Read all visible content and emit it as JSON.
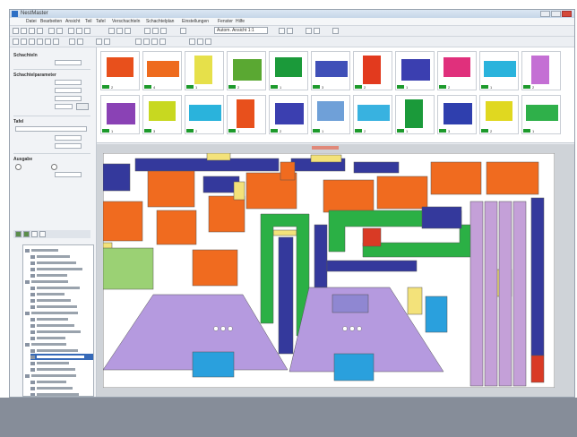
{
  "window": {
    "title": "NestMaster"
  },
  "menubar": [
    "Datei",
    "Bearbeiten",
    "Ansicht",
    "Teil",
    "Tafel",
    "Verschachteln",
    "Schachtelplan",
    "Einstellungen",
    "Fenster",
    "Hilfe"
  ],
  "toolbar": {
    "combo_value": "Autom. Ansicht 1:1"
  },
  "left_panel": {
    "sections": [
      "Schachteln",
      "Schachtelparameter",
      "Tafel",
      "Ausgabe"
    ]
  },
  "part_thumbnails": [
    {
      "color": "#e8501c",
      "qty": "2"
    },
    {
      "color": "#ee6b1e",
      "qty": "4"
    },
    {
      "color": "#e6e04a",
      "qty": "1"
    },
    {
      "color": "#5aa832",
      "qty": "2"
    },
    {
      "color": "#1b9a3a",
      "qty": "1"
    },
    {
      "color": "#4050b8",
      "qty": "3"
    },
    {
      "color": "#e23a1e",
      "qty": "2"
    },
    {
      "color": "#3b3fb0",
      "qty": "1"
    },
    {
      "color": "#e0307c",
      "qty": "2"
    },
    {
      "color": "#2ab3dc",
      "qty": "1"
    },
    {
      "color": "#c46fd4",
      "qty": "2"
    },
    {
      "color": "#8a42b5",
      "qty": "1"
    },
    {
      "color": "#c8d820",
      "qty": "3"
    },
    {
      "color": "#2ab3dc",
      "qty": "2"
    },
    {
      "color": "#e8501c",
      "qty": "1"
    },
    {
      "color": "#3b3fb0",
      "qty": "2"
    },
    {
      "color": "#6fa0d8",
      "qty": "1"
    },
    {
      "color": "#38b2e0",
      "qty": "2"
    },
    {
      "color": "#1b9a3a",
      "qty": "1"
    },
    {
      "color": "#2f3fae",
      "qty": "3"
    },
    {
      "color": "#e0d820",
      "qty": "2"
    },
    {
      "color": "#2fb04a",
      "qty": "1"
    }
  ],
  "colors": {
    "orange": "#f06b1f",
    "navy": "#34399c",
    "violet": "#b59adf",
    "lilac": "#c4a0d8",
    "green": "#2bb045",
    "lightgreen": "#9bd174",
    "cyan": "#2aa0dd",
    "yellow": "#f3e27a",
    "red": "#d93a25"
  }
}
